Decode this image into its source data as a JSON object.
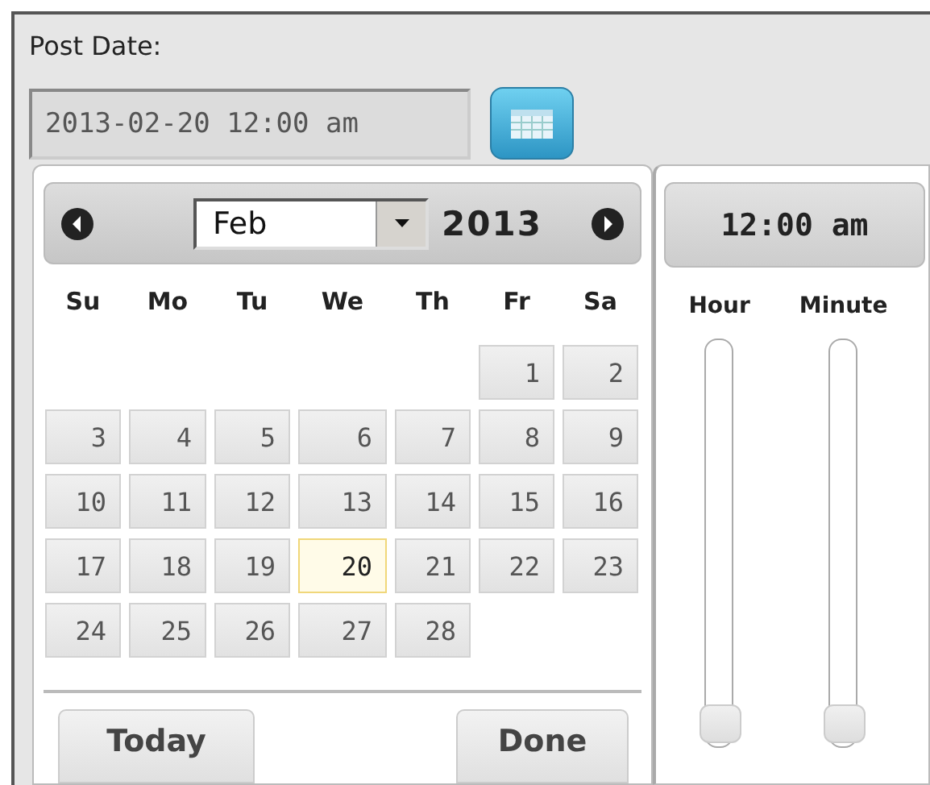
{
  "field": {
    "label": "Post Date:",
    "value": "2013-02-20 12:00 am"
  },
  "calendar": {
    "month": "Feb",
    "year": "2013",
    "weekdays": [
      "Su",
      "Mo",
      "Tu",
      "We",
      "Th",
      "Fr",
      "Sa"
    ],
    "weeks": [
      [
        {
          "kind": "blank"
        },
        {
          "kind": "blank"
        },
        {
          "kind": "blank"
        },
        {
          "kind": "blank"
        },
        {
          "kind": "blank"
        },
        {
          "kind": "day",
          "day": "1",
          "selected": false
        },
        {
          "kind": "day",
          "day": "2",
          "selected": false
        }
      ],
      [
        {
          "kind": "day",
          "day": "3",
          "selected": false
        },
        {
          "kind": "day",
          "day": "4",
          "selected": false
        },
        {
          "kind": "day",
          "day": "5",
          "selected": false
        },
        {
          "kind": "day",
          "day": "6",
          "selected": false
        },
        {
          "kind": "day",
          "day": "7",
          "selected": false
        },
        {
          "kind": "day",
          "day": "8",
          "selected": false
        },
        {
          "kind": "day",
          "day": "9",
          "selected": false
        }
      ],
      [
        {
          "kind": "day",
          "day": "10",
          "selected": false
        },
        {
          "kind": "day",
          "day": "11",
          "selected": false
        },
        {
          "kind": "day",
          "day": "12",
          "selected": false
        },
        {
          "kind": "day",
          "day": "13",
          "selected": false
        },
        {
          "kind": "day",
          "day": "14",
          "selected": false
        },
        {
          "kind": "day",
          "day": "15",
          "selected": false
        },
        {
          "kind": "day",
          "day": "16",
          "selected": false
        }
      ],
      [
        {
          "kind": "day",
          "day": "17",
          "selected": false
        },
        {
          "kind": "day",
          "day": "18",
          "selected": false
        },
        {
          "kind": "day",
          "day": "19",
          "selected": false
        },
        {
          "kind": "day",
          "day": "20",
          "selected": true
        },
        {
          "kind": "day",
          "day": "21",
          "selected": false
        },
        {
          "kind": "day",
          "day": "22",
          "selected": false
        },
        {
          "kind": "day",
          "day": "23",
          "selected": false
        }
      ],
      [
        {
          "kind": "day",
          "day": "24",
          "selected": false
        },
        {
          "kind": "day",
          "day": "25",
          "selected": false
        },
        {
          "kind": "day",
          "day": "26",
          "selected": false
        },
        {
          "kind": "day",
          "day": "27",
          "selected": false
        },
        {
          "kind": "day",
          "day": "28",
          "selected": false
        },
        {
          "kind": "blank"
        },
        {
          "kind": "blank"
        }
      ]
    ],
    "buttons": [
      "Today",
      "Done"
    ]
  },
  "time": {
    "display": "12:00 am",
    "sliders": [
      {
        "label": "Hour",
        "level": 0
      },
      {
        "label": "Minute",
        "level": 0
      }
    ]
  }
}
